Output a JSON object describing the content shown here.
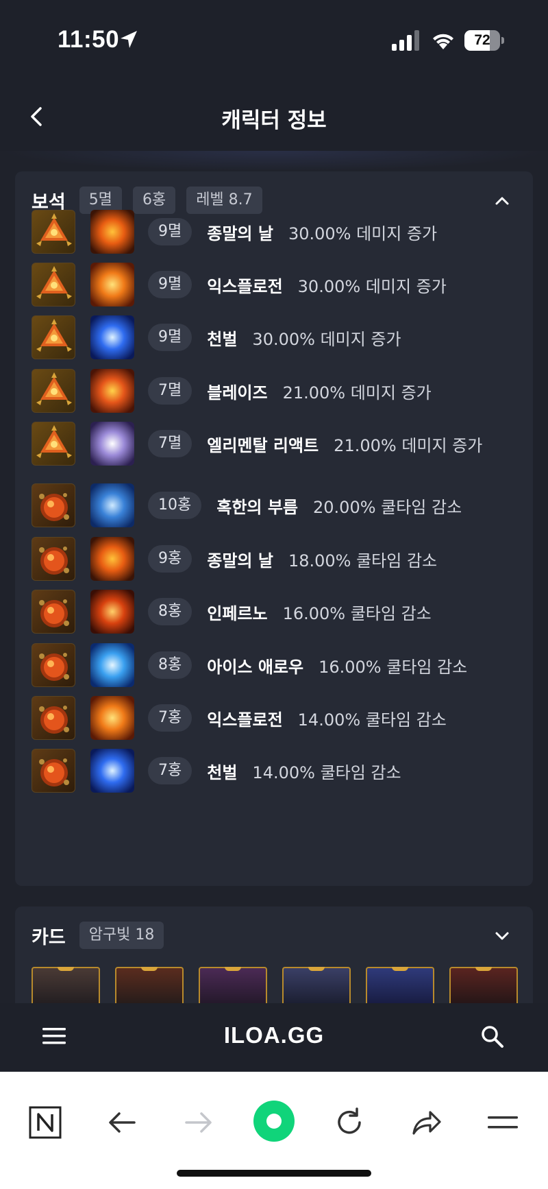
{
  "status_bar": {
    "time": "11:50",
    "battery": "72",
    "battery_level": 0.72
  },
  "header": {
    "title": "캐릭터 정보"
  },
  "gems": {
    "title": "보석",
    "tags": [
      "5멸",
      "6홍",
      "레벨 8.7"
    ],
    "rows": [
      {
        "level": "9멸",
        "skill": "종말의 날",
        "effect": "30.00% 데미지 증가",
        "gem": "doom",
        "skill_icon": "meteor"
      },
      {
        "level": "9멸",
        "skill": "익스플로전",
        "effect": "30.00% 데미지 증가",
        "gem": "doom",
        "skill_icon": "fireball"
      },
      {
        "level": "9멸",
        "skill": "천벌",
        "effect": "30.00% 데미지 증가",
        "gem": "doom",
        "skill_icon": "lightning"
      },
      {
        "level": "7멸",
        "skill": "블레이즈",
        "effect": "21.00% 데미지 증가",
        "gem": "doom",
        "skill_icon": "blaze"
      },
      {
        "level": "7멸",
        "skill": "엘리멘탈 리액트",
        "effect": "21.00% 데미지 증가",
        "gem": "doom",
        "skill_icon": "crystal"
      },
      {
        "level": "10홍",
        "skill": "혹한의 부름",
        "effect": "20.00% 쿨타임 감소",
        "gem": "ruby",
        "skill_icon": "frost"
      },
      {
        "level": "9홍",
        "skill": "종말의 날",
        "effect": "18.00% 쿨타임 감소",
        "gem": "ruby",
        "skill_icon": "meteor"
      },
      {
        "level": "8홍",
        "skill": "인페르노",
        "effect": "16.00% 쿨타임 감소",
        "gem": "ruby",
        "skill_icon": "inferno"
      },
      {
        "level": "8홍",
        "skill": "아이스 애로우",
        "effect": "16.00% 쿨타임 감소",
        "gem": "ruby",
        "skill_icon": "ice-arrow"
      },
      {
        "level": "7홍",
        "skill": "익스플로전",
        "effect": "14.00% 쿨타임 감소",
        "gem": "ruby",
        "skill_icon": "fireball"
      },
      {
        "level": "7홍",
        "skill": "천벌",
        "effect": "14.00% 쿨타임 감소",
        "gem": "ruby",
        "skill_icon": "lightning"
      }
    ]
  },
  "cards": {
    "title": "카드",
    "tags": [
      "암구빛 18"
    ]
  },
  "site_bar": {
    "logo": "ILOA.GG"
  },
  "colors": {
    "background": "#1f222b",
    "panel": "#262a35",
    "tag": "#383d4a",
    "accent_green": "#10d47a"
  }
}
